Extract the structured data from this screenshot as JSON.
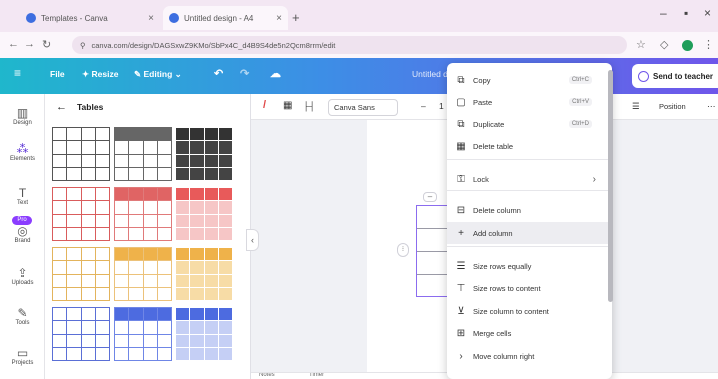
{
  "browser": {
    "tabs": [
      {
        "title": "Templates - Canva"
      },
      {
        "title": "Untitled design - A4"
      }
    ],
    "new_tab_label": "+",
    "close_label": "×",
    "window_controls": {
      "minimize": "–",
      "restore": "▪",
      "close": "×"
    },
    "url": "canva.com/design/DAGSxwZ9KMo/SbPx4C_d4B9S4de5n2Qcm8rrm/edit"
  },
  "appbar": {
    "menu_icon": "≡",
    "file_label": "File",
    "resize_label": "✦ Resize",
    "editing_label": "Editing",
    "undo": "↶",
    "redo": "↷",
    "cloud": "☁",
    "design_title": "Untitled design",
    "send_button": "Send to teacher"
  },
  "rail": [
    {
      "icon": "▥",
      "label": "Design"
    },
    {
      "icon": "⁂",
      "label": "Elements"
    },
    {
      "icon": "T",
      "label": "Text"
    },
    {
      "icon": "◎",
      "label": "Brand",
      "badge": "Pro"
    },
    {
      "icon": "⇪",
      "label": "Uploads"
    },
    {
      "icon": "✎",
      "label": "Tools"
    },
    {
      "icon": "▭",
      "label": "Projects"
    }
  ],
  "panel": {
    "back": "←",
    "title": "Tables"
  },
  "table_styles": [
    {
      "header": "#ffffff",
      "body": "#ffffff",
      "line": "#555555",
      "headerLine": "#555555"
    },
    {
      "header": "#666666",
      "body": "#ffffff",
      "line": "#666666",
      "headerLine": "#666666"
    },
    {
      "header": "#333333",
      "body": "#444444",
      "line": "#ffffff",
      "headerLine": "#ffffff"
    },
    {
      "header": "#ffffff",
      "body": "#ffffff",
      "line": "#d95c5c",
      "headerLine": "#d95c5c"
    },
    {
      "header": "#e06464",
      "body": "#ffffff",
      "line": "#e07a7a",
      "headerLine": "#e06464"
    },
    {
      "header": "#e85a5a",
      "body": "#f6c6c6",
      "line": "#ffffff",
      "headerLine": "#ffffff"
    },
    {
      "header": "#ffffff",
      "body": "#ffffff",
      "line": "#e3b45c",
      "headerLine": "#e3b45c"
    },
    {
      "header": "#efb24a",
      "body": "#ffffff",
      "line": "#ecc27a",
      "headerLine": "#efb24a"
    },
    {
      "header": "#efb24a",
      "body": "#f7dca6",
      "line": "#ffffff",
      "headerLine": "#ffffff"
    },
    {
      "header": "#ffffff",
      "body": "#ffffff",
      "line": "#5a6fd6",
      "headerLine": "#5a6fd6"
    },
    {
      "header": "#4d6be0",
      "body": "#ffffff",
      "line": "#6f86e6",
      "headerLine": "#4d6be0"
    },
    {
      "header": "#4d6be0",
      "body": "#c5cff5",
      "line": "#ffffff",
      "headerLine": "#ffffff"
    }
  ],
  "toolbar": {
    "color_icon": "/",
    "border_icon": "▦",
    "spacing_icon": "├┤",
    "font": "Canva Sans",
    "size_minus": "–",
    "size_value": "1",
    "align_icon": "☰",
    "position_label": "Position",
    "more": "⋯"
  },
  "canvas": {
    "minus": "–",
    "handle": "⁝"
  },
  "bottom": {
    "notes": "Notes",
    "timer": "Timer"
  },
  "context_menu": [
    {
      "icon": "⧉",
      "label": "Copy",
      "shortcut": "Ctrl+C"
    },
    {
      "icon": "▢",
      "label": "Paste",
      "shortcut": "Ctrl+V"
    },
    {
      "icon": "⧉",
      "label": "Duplicate",
      "shortcut": "Ctrl+D"
    },
    {
      "icon": "▦",
      "label": "Delete table"
    },
    {
      "icon": "⚿",
      "label": "Lock",
      "arrow": "›"
    },
    {
      "icon": "⊟",
      "label": "Delete column"
    },
    {
      "icon": "+",
      "label": "Add column"
    },
    {
      "icon": "☰",
      "label": "Size rows equally"
    },
    {
      "icon": "⊤",
      "label": "Size rows to content"
    },
    {
      "icon": "⊻",
      "label": "Size column to content"
    },
    {
      "icon": "⊞",
      "label": "Merge cells"
    },
    {
      "icon": "›",
      "label": "Move column right"
    }
  ]
}
